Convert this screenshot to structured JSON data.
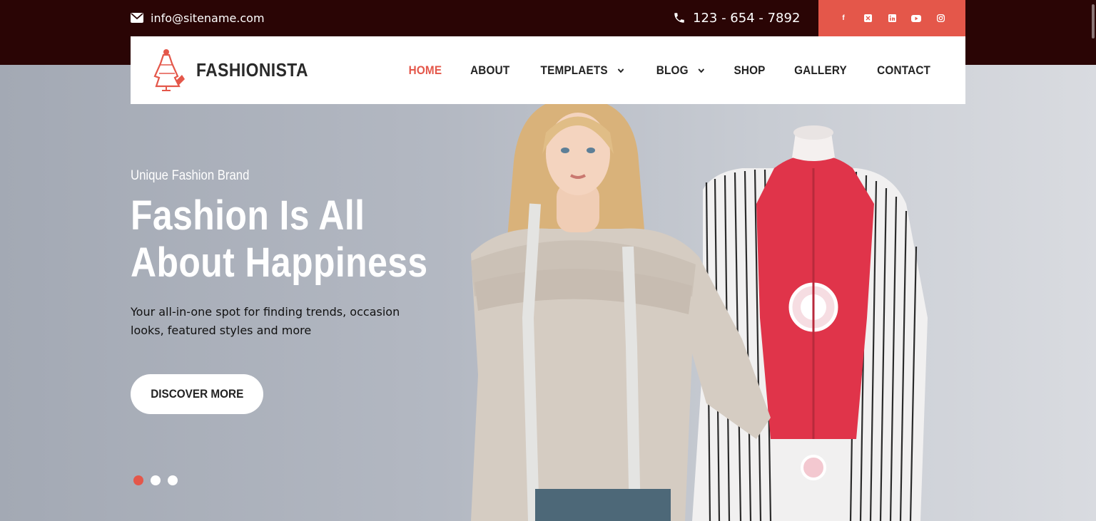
{
  "topbar": {
    "email": "info@sitename.com",
    "phone": "123 - 654 - 7892",
    "social": [
      "facebook-icon",
      "x-twitter-icon",
      "linkedin-icon",
      "youtube-icon",
      "instagram-icon"
    ]
  },
  "brand": {
    "name": "FASHIONISTA",
    "accent": "#e4574a",
    "dark": "#2a0505"
  },
  "nav": {
    "items": [
      {
        "label": "HOME",
        "active": true
      },
      {
        "label": "ABOUT"
      },
      {
        "label": "TEMPLAETS",
        "dropdown": true
      },
      {
        "label": "BLOG",
        "dropdown": true
      },
      {
        "label": "SHOP"
      },
      {
        "label": "GALLERY"
      },
      {
        "label": "CONTACT"
      }
    ]
  },
  "hero": {
    "eyebrow": "Unique Fashion Brand",
    "headline_line1": "Fashion Is All",
    "headline_line2": "About Happiness",
    "description": "Your all-in-one spot for finding trends, occasion looks, featured styles and more",
    "cta": "DISCOVER MORE",
    "slides": 3,
    "active_slide": 1
  }
}
